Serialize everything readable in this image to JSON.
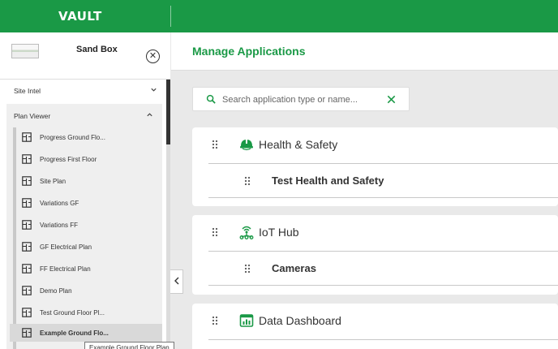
{
  "brand": {
    "logo_text": "VAULT",
    "accent": "#1a9946"
  },
  "sidebar": {
    "project_name": "Sand Box",
    "close_icon": "close-circle-icon",
    "sections": [
      {
        "label": "Site Intel",
        "expanded": false
      },
      {
        "label": "Plan Viewer",
        "expanded": true
      }
    ],
    "plans": [
      {
        "label": "Progress Ground Flo..."
      },
      {
        "label": "Progress First Floor"
      },
      {
        "label": "Site Plan"
      },
      {
        "label": "Variations GF"
      },
      {
        "label": "Variations FF"
      },
      {
        "label": "GF Electrical Plan"
      },
      {
        "label": "FF Electrical Plan"
      },
      {
        "label": "Demo Plan"
      },
      {
        "label": "Test Ground Floor Pl..."
      },
      {
        "label": "Example Ground Flo..."
      }
    ],
    "active_plan_index": 9,
    "tooltip": "Example Ground Floor Plan",
    "collapse_icon": "chevron-left-icon"
  },
  "main": {
    "title": "Manage Applications",
    "search": {
      "placeholder": "Search application type or name...",
      "value": ""
    },
    "groups": [
      {
        "name": "Health & Safety",
        "icon": "hard-hat-icon",
        "apps": [
          "Test Health and Safety"
        ]
      },
      {
        "name": "IoT Hub",
        "icon": "iot-hub-icon",
        "apps": [
          "Cameras"
        ]
      },
      {
        "name": "Data Dashboard",
        "icon": "dashboard-icon",
        "apps": []
      }
    ]
  }
}
